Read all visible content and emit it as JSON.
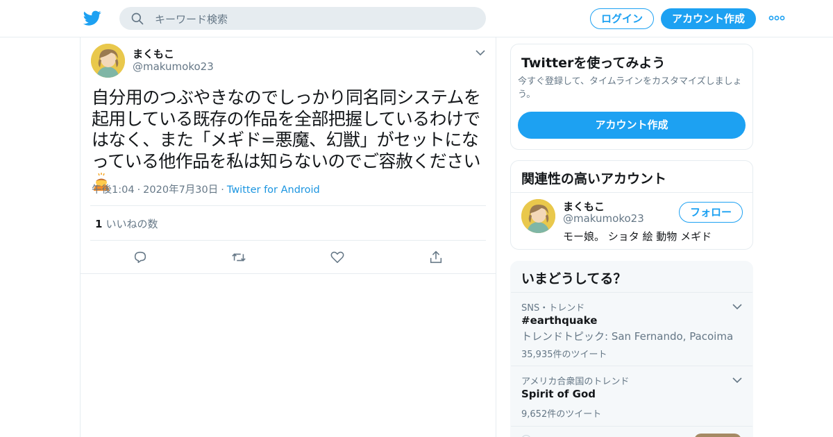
{
  "header": {
    "search_placeholder": "キーワード検索",
    "login_label": "ログイン",
    "signup_label": "アカウント作成",
    "colors": {
      "brand": "#1da1f2"
    }
  },
  "tweet": {
    "name": "まくもこ",
    "handle": "@makumoko23",
    "text": "自分用のつぶやきなのでしっかり同名同システムを起用している既存の作品を全部把握しているわけではなく、また「メギド=悪魔、幻獣」がセットになっている他作品を私は知らないのでご容赦ください",
    "emoji_icon": "person-bowing-emoji",
    "time": "午後1:04",
    "date": "2020年7月30日",
    "source": "Twitter for Android",
    "likes_count": "1",
    "likes_label": "いいねの数",
    "actions": [
      "reply-icon",
      "retweet-icon",
      "like-icon",
      "share-icon"
    ]
  },
  "signup_card": {
    "title": "Twitterを使ってみよう",
    "subtitle": "今すぐ登録して、タイムラインをカスタマイズしましょう。",
    "cta_label": "アカウント作成"
  },
  "related_card": {
    "title": "関連性の高いアカウント",
    "name": "まくもこ",
    "handle": "@makumoko23",
    "bio": "モー娘。 ショタ 絵 動物 メギド",
    "follow_label": "フォロー"
  },
  "trends_card": {
    "title": "いまどうしてる？",
    "items": [
      {
        "context": "SNS・トレンド",
        "name": "#earthquake",
        "desc": "トレンドトピック: San Fernando, Pacoima",
        "count": "35,935件のツイート"
      },
      {
        "context": "アメリカ合衆国のトレンド",
        "name": "Spirit of God",
        "desc": "",
        "count": "9,652件のツイート"
      }
    ]
  }
}
